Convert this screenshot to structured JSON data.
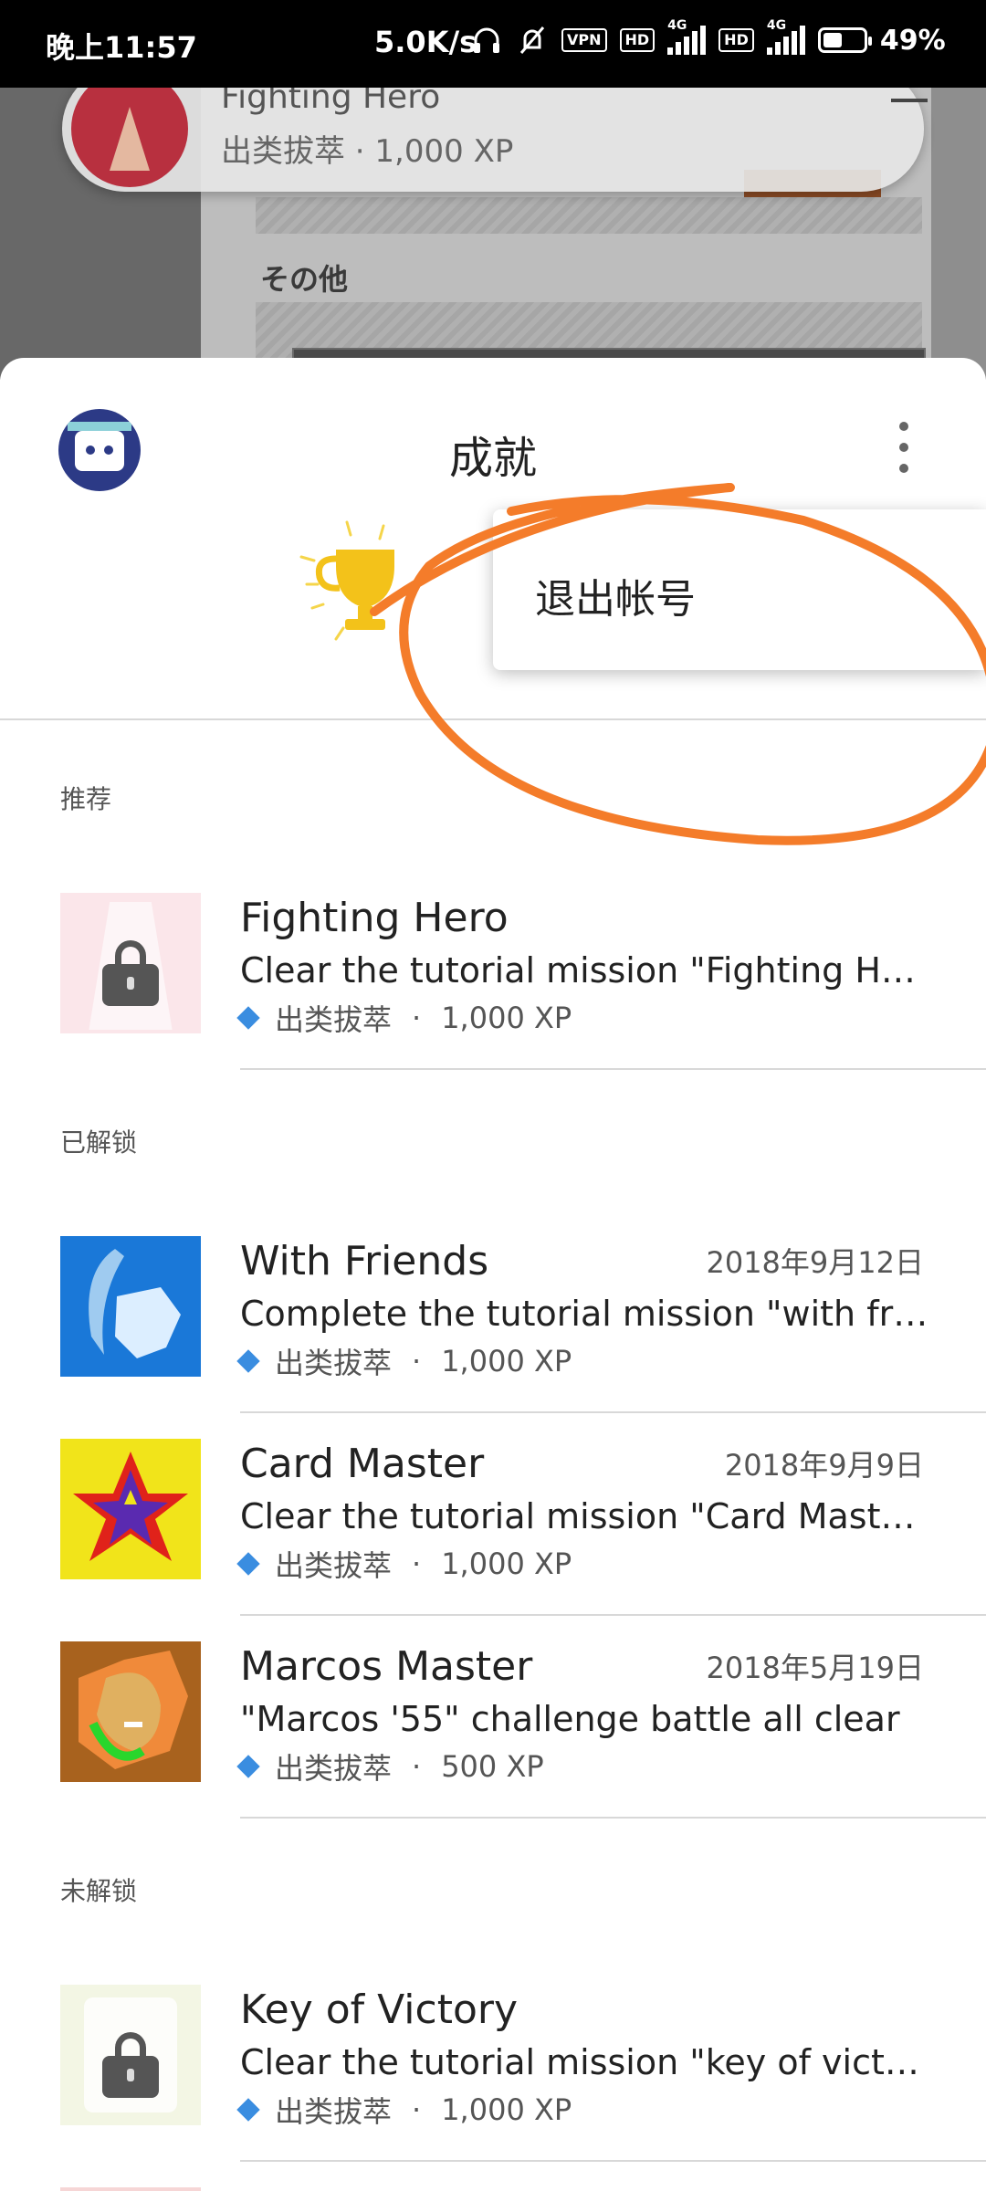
{
  "status_bar": {
    "time": "晚上11:57",
    "net_speed": "5.0K/s",
    "vpn": "VPN",
    "hd": "HD",
    "net1": "4G",
    "net2": "4G",
    "battery": "49%",
    "battery_level": 0.49
  },
  "background": {
    "notification_title": "Fighting Hero",
    "notification_sub": "出类拔萃 · 1,000 XP",
    "other_label": "その他"
  },
  "sheet": {
    "title": "成就"
  },
  "menu": {
    "items": [
      "退出帐号"
    ]
  },
  "sections": {
    "recommended": "推荐",
    "unlocked": "已解锁",
    "locked": "未解锁"
  },
  "achievements": {
    "recommended": [
      {
        "title": "Fighting Hero",
        "desc": "Clear the tutorial mission \"Fighting H…",
        "rank": "出类拔萃",
        "xp": "1,000 XP",
        "date": ""
      }
    ],
    "unlocked": [
      {
        "title": "With Friends",
        "desc": "Complete the tutorial mission \"with fr…",
        "rank": "出类拔萃",
        "xp": "1,000 XP",
        "date": "2018年9月12日"
      },
      {
        "title": "Card Master",
        "desc": "Clear the tutorial mission \"Card Mast…",
        "rank": "出类拔萃",
        "xp": "1,000 XP",
        "date": "2018年9月9日"
      },
      {
        "title": "Marcos Master",
        "desc": "\"Marcos '55\" challenge battle all clear",
        "rank": "出类拔萃",
        "xp": "500 XP",
        "date": "2018年5月19日"
      }
    ],
    "locked": [
      {
        "title": "Key of Victory",
        "desc": "Clear the tutorial mission \"key of vict…",
        "rank": "出类拔萃",
        "xp": "1,000 XP",
        "date": ""
      }
    ],
    "dot": "·"
  },
  "colors": {
    "annotation": "#f47c2a",
    "diamond": "#3a8de0"
  }
}
